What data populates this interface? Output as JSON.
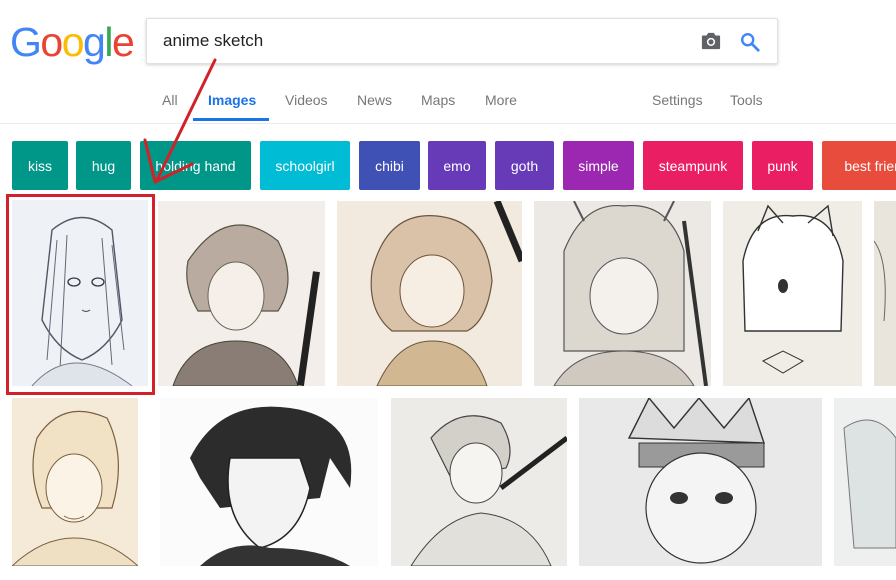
{
  "logo": {
    "letters": [
      "G",
      "o",
      "o",
      "g",
      "l",
      "e"
    ],
    "colors": [
      "#4285F4",
      "#EA4335",
      "#FBBC05",
      "#4285F4",
      "#34A853",
      "#EA4335"
    ]
  },
  "search": {
    "query": "anime sketch",
    "camera_icon": "camera-icon",
    "search_icon": "search-icon"
  },
  "tabs": {
    "items": [
      {
        "label": "All",
        "active": false
      },
      {
        "label": "Images",
        "active": true
      },
      {
        "label": "Videos",
        "active": false
      },
      {
        "label": "News",
        "active": false
      },
      {
        "label": "Maps",
        "active": false
      },
      {
        "label": "More",
        "active": false
      }
    ],
    "settings": "Settings",
    "tools": "Tools",
    "active_color": "#1a73e8"
  },
  "chips": [
    {
      "label": "kiss",
      "color": "#009688"
    },
    {
      "label": "hug",
      "color": "#009688"
    },
    {
      "label": "holding hand",
      "color": "#009688"
    },
    {
      "label": "schoolgirl",
      "color": "#00bcd4"
    },
    {
      "label": "chibi",
      "color": "#3f51b5"
    },
    {
      "label": "emo",
      "color": "#673ab7"
    },
    {
      "label": "goth",
      "color": "#673ab7"
    },
    {
      "label": "simple",
      "color": "#9c27b0"
    },
    {
      "label": "steampunk",
      "color": "#e91e63"
    },
    {
      "label": "punk",
      "color": "#e91e63"
    },
    {
      "label": "best friend",
      "color": "#e74c3c"
    }
  ],
  "annotation": {
    "highlight_color": "#d22128"
  }
}
